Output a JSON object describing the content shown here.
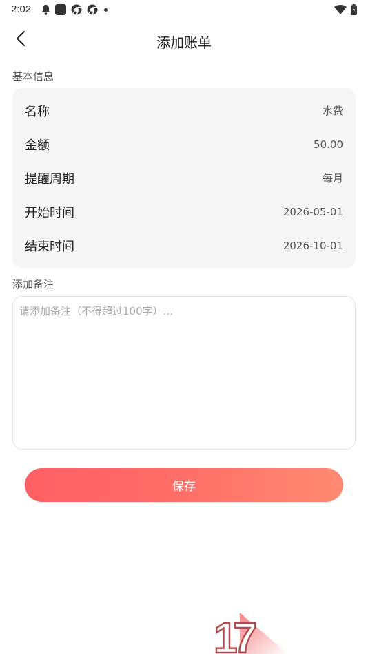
{
  "status_bar": {
    "time": "2:02",
    "left_icons": [
      "bell-icon",
      "square-icon",
      "chrome-icon",
      "chrome-icon",
      "dot-icon"
    ],
    "right_icons": [
      "wifi-icon",
      "battery-icon"
    ]
  },
  "nav": {
    "title": "添加账单",
    "back_icon": "chevron-left-icon"
  },
  "basic_info": {
    "section_label": "基本信息",
    "rows": [
      {
        "label": "名称",
        "value": "水费"
      },
      {
        "label": "金额",
        "value": "50.00"
      },
      {
        "label": "提醒周期",
        "value": "每月"
      },
      {
        "label": "开始时间",
        "value": "2026-05-01"
      },
      {
        "label": "结束时间",
        "value": "2026-10-01"
      }
    ]
  },
  "remark": {
    "section_label": "添加备注",
    "value": "",
    "placeholder": "请添加备注（不得超过100字）..."
  },
  "save_button": {
    "label": "保存",
    "gradient_start": "#ff5f64",
    "gradient_end": "#ff8a72"
  },
  "watermark": {
    "text": "17"
  }
}
